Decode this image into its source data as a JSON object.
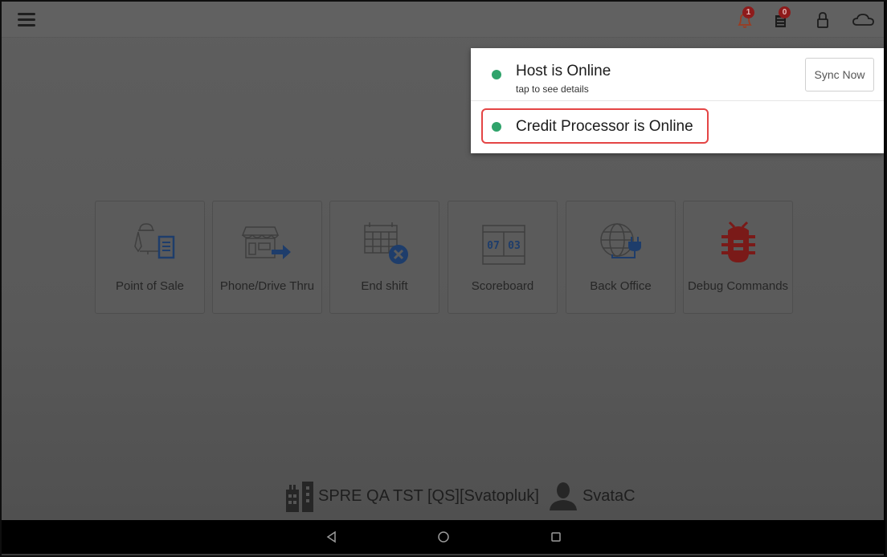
{
  "topbar": {
    "menu_icon": "hamburger-menu-icon",
    "icons": [
      {
        "name": "notifications-bell-icon",
        "badge": "1"
      },
      {
        "name": "receipt-icon",
        "badge": "0"
      },
      {
        "name": "lock-icon"
      },
      {
        "name": "cloud-icon"
      }
    ]
  },
  "status_panel": {
    "host": {
      "title": "Host is Online",
      "subtitle": "tap to see details",
      "status_color": "#2fa36b"
    },
    "credit": {
      "title": "Credit Processor is Online",
      "status_color": "#2fa36b"
    },
    "sync_button": "Sync Now",
    "highlight_color": "#e44545"
  },
  "tiles": [
    {
      "label": "Point of Sale",
      "icon": "point-of-sale-icon"
    },
    {
      "label": "Phone/Drive Thru",
      "icon": "phone-drive-thru-icon"
    },
    {
      "label": "End shift",
      "icon": "end-shift-icon"
    },
    {
      "label": "Scoreboard",
      "icon": "scoreboard-icon",
      "digits": [
        "07",
        "03"
      ]
    },
    {
      "label": "Back Office",
      "icon": "back-office-icon"
    },
    {
      "label": "Debug Commands",
      "icon": "debug-bug-icon"
    }
  ],
  "footer": {
    "store": "SPRE QA TST [QS][Svatopluk]",
    "user": "SvataC"
  },
  "navbar": {
    "back": "back-icon",
    "home": "home-icon",
    "recents": "recents-icon"
  }
}
